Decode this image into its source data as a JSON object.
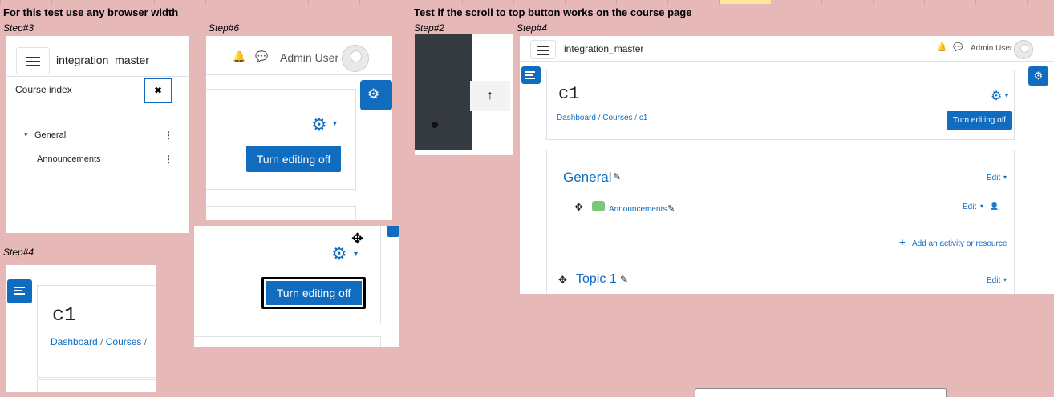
{
  "header": {
    "left_note": "For this test use any browser width",
    "title": "Test if the scroll to top button works on the course page"
  },
  "steps": {
    "step3": "Step#3",
    "step6": "Step#6",
    "step2": "Step#2",
    "step4a": "Step#4",
    "step4b": "Step#4"
  },
  "site": {
    "name": "integration_master",
    "user": "Admin User"
  },
  "course_index": {
    "title": "Course index",
    "close": "✖",
    "items": [
      "General",
      "Announcements"
    ]
  },
  "buttons": {
    "turn_editing_off": "Turn editing off",
    "scroll_top": "↑"
  },
  "course": {
    "name": "c1",
    "breadcrumb": [
      "Dashboard",
      "Courses",
      "c1"
    ],
    "separator": "/",
    "sections": [
      {
        "title": "General",
        "edit": "Edit"
      },
      {
        "title": "Topic 1",
        "edit": "Edit"
      }
    ],
    "activity": {
      "name": "Announcements",
      "edit": "Edit"
    },
    "add_activity": "Add an activity or resource"
  },
  "icons": {
    "caret": "▾",
    "gear": "⚙",
    "bell": "🔔",
    "chat": "💬",
    "move": "✥",
    "pencil": "✎",
    "plus": "+",
    "user": "👤",
    "kebab": "⋮"
  }
}
